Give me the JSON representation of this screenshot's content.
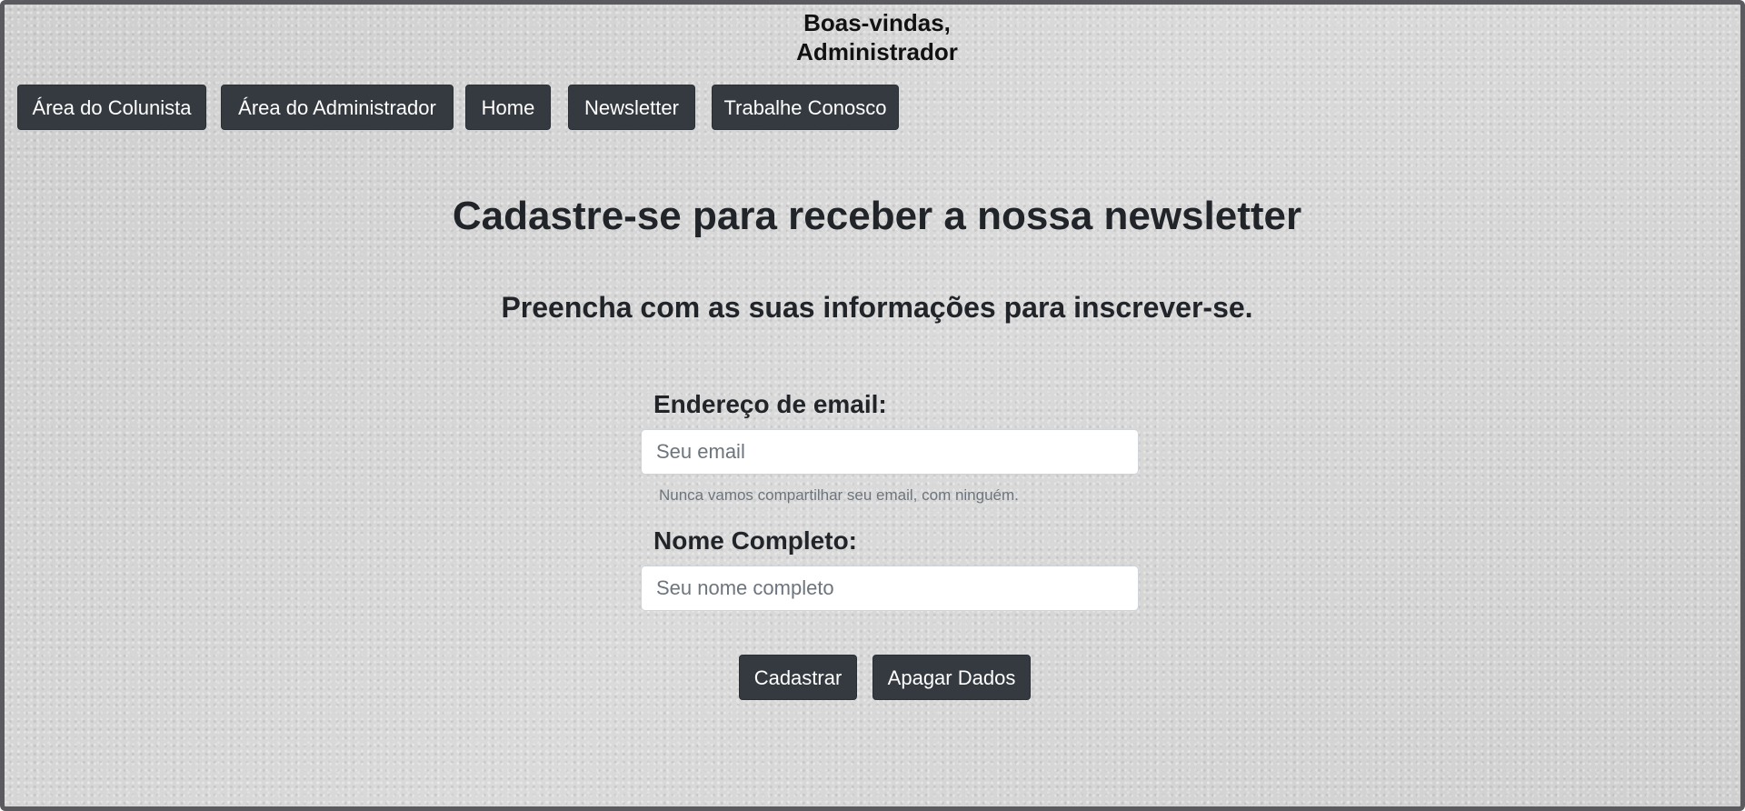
{
  "header": {
    "welcome_line1": "Boas-vindas,",
    "welcome_line2": "Administrador"
  },
  "nav": {
    "items": [
      {
        "label": "Área do Colunista"
      },
      {
        "label": "Área do Administrador"
      },
      {
        "label": "Home"
      },
      {
        "label": "Newsletter"
      },
      {
        "label": "Trabalhe Conosco"
      }
    ]
  },
  "main": {
    "title": "Cadastre-se para receber a nossa newsletter",
    "subtitle": "Preencha com as suas informações para inscrever-se."
  },
  "form": {
    "email_label": "Endereço de email:",
    "email_placeholder": "Seu email",
    "email_value": "",
    "email_help": "Nunca vamos compartilhar seu email, com ninguém.",
    "name_label": "Nome Completo:",
    "name_placeholder": "Seu nome completo",
    "name_value": "",
    "submit_label": "Cadastrar",
    "clear_label": "Apagar Dados"
  },
  "colors": {
    "button_bg": "#343a40",
    "page_bg": "#d3d3d3",
    "text": "#212529",
    "help_text": "#6c757d"
  }
}
